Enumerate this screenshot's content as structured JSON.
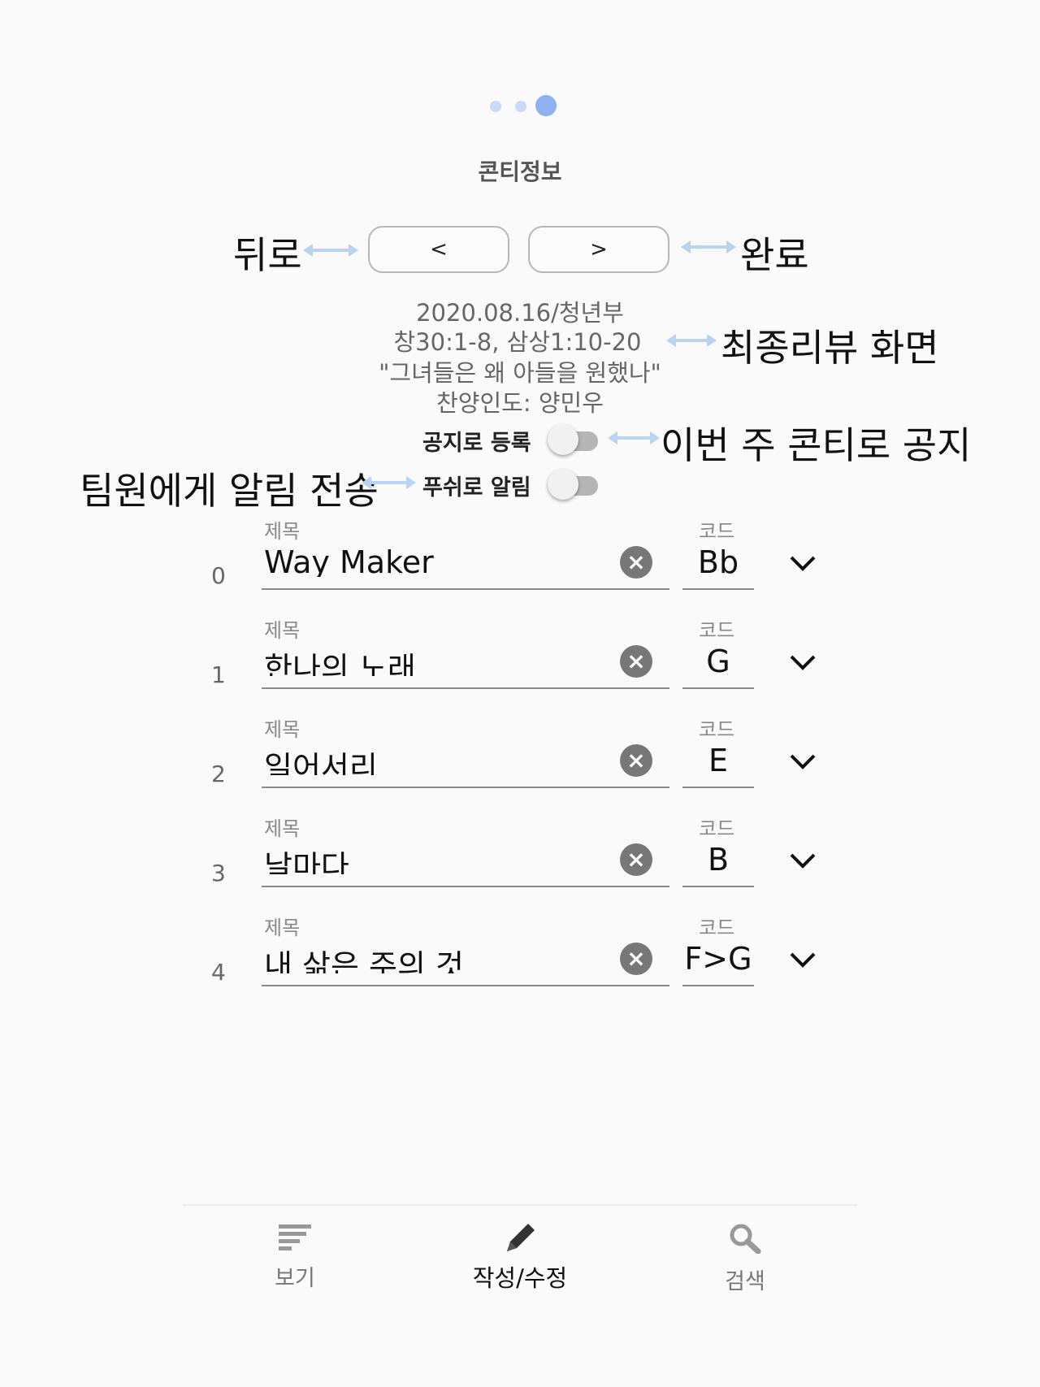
{
  "header": {
    "title": "콘티정보",
    "pager": {
      "count": 3,
      "active_index": 2
    }
  },
  "nav": {
    "back_label": "<",
    "next_label": ">"
  },
  "annotations": {
    "back": "뒤로",
    "done": "완료",
    "final_review": "최종리뷰 화면",
    "notice": "이번 주 콘티로 공지",
    "team_alert": "팀원에게 알림 전송"
  },
  "info": {
    "date_team": "2020.08.16/청년부",
    "scripture": "창30:1-8, 삼상1:10-20",
    "sermon_title": "\"그녀들은 왜 아들을 원했나\"",
    "worship_leader": "찬양인도: 양민우"
  },
  "toggles": {
    "notice_label": "공지로 등록",
    "notice_on": false,
    "push_label": "푸쉬로 알림",
    "push_on": false
  },
  "songs_labels": {
    "title_label": "제목",
    "code_label": "코드"
  },
  "songs": [
    {
      "index": "0",
      "title": "Way Maker",
      "code": "Bb"
    },
    {
      "index": "1",
      "title": "한나의 노래",
      "code": "G"
    },
    {
      "index": "2",
      "title": "일어서리",
      "code": "E"
    },
    {
      "index": "3",
      "title": "날마다",
      "code": "B"
    },
    {
      "index": "4",
      "title": "내 삶은 주의 것",
      "code": "F>G"
    }
  ],
  "bottom_nav": {
    "tabs": [
      {
        "label": "보기",
        "icon": "list-icon",
        "active": false
      },
      {
        "label": "작성/수정",
        "icon": "pencil-icon",
        "active": true
      },
      {
        "label": "검색",
        "icon": "search-icon",
        "active": false
      }
    ]
  }
}
